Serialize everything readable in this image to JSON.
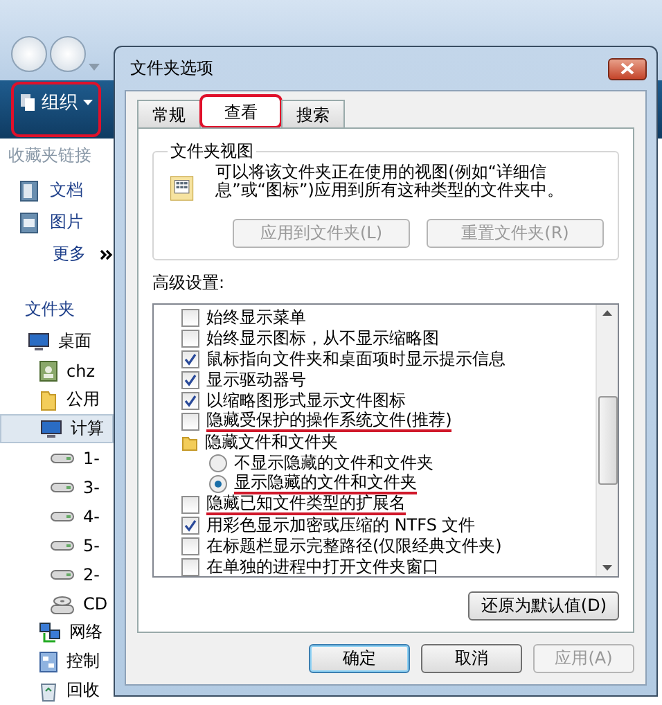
{
  "explorer": {
    "organize_button": {
      "label": "组织",
      "circled": true
    },
    "favorites_header": "收藏夹链接",
    "favorites": [
      {
        "label": "文档",
        "kind": "document"
      },
      {
        "label": "图片",
        "kind": "picture"
      }
    ],
    "more": "更多",
    "folders_header": "文件夹",
    "tree": [
      {
        "label": "桌面",
        "kind": "desktop",
        "selected": false,
        "children": [
          {
            "label": "chz",
            "kind": "user",
            "selected": false
          },
          {
            "label": "公用",
            "kind": "folder",
            "selected": false
          },
          {
            "label": "计算",
            "kind": "computer",
            "selected": true,
            "children": [
              {
                "label": "1-",
                "kind": "drive",
                "selected": false
              },
              {
                "label": "3-",
                "kind": "drive",
                "selected": false
              },
              {
                "label": "4-",
                "kind": "drive",
                "selected": false
              },
              {
                "label": "5-",
                "kind": "drive",
                "selected": false
              },
              {
                "label": "2-",
                "kind": "drive",
                "selected": false
              },
              {
                "label": "CD",
                "kind": "cdrom",
                "selected": false
              }
            ]
          },
          {
            "label": "网络",
            "kind": "network",
            "selected": false
          },
          {
            "label": "控制",
            "kind": "control",
            "selected": false
          },
          {
            "label": "回收",
            "kind": "recycle",
            "selected": false
          }
        ]
      }
    ]
  },
  "dialog": {
    "title": "文件夹选项",
    "tabs": [
      {
        "label": "常规",
        "selected": false,
        "circled": false
      },
      {
        "label": "查看",
        "selected": true,
        "circled": true
      },
      {
        "label": "搜索",
        "selected": false,
        "circled": false
      }
    ],
    "folder_view": {
      "title": "文件夹视图",
      "description": "可以将该文件夹正在使用的视图(例如“详细信息”或“图标”)应用到所有这种类型的文件夹中。",
      "buttons": [
        {
          "label": "应用到文件夹(L)",
          "disabled": true
        },
        {
          "label": "重置文件夹(R)",
          "disabled": true
        }
      ]
    },
    "advanced": {
      "label": "高级设置:",
      "items": [
        {
          "kind": "checkbox",
          "label": "始终显示菜单",
          "checked": false,
          "underlined": false
        },
        {
          "kind": "checkbox",
          "label": "始终显示图标，从不显示缩略图",
          "checked": false,
          "underlined": false
        },
        {
          "kind": "checkbox",
          "label": "鼠标指向文件夹和桌面项时显示提示信息",
          "checked": true,
          "underlined": false
        },
        {
          "kind": "checkbox",
          "label": "显示驱动器号",
          "checked": true,
          "underlined": false
        },
        {
          "kind": "checkbox",
          "label": "以缩略图形式显示文件图标",
          "checked": true,
          "underlined": false
        },
        {
          "kind": "checkbox",
          "label": "隐藏受保护的操作系统文件(推荐)",
          "checked": false,
          "underlined": true
        },
        {
          "kind": "group",
          "label": "隐藏文件和文件夹",
          "underlined": false,
          "children": [
            {
              "kind": "radio",
              "label": "不显示隐藏的文件和文件夹",
              "selected": false,
              "underlined": false
            },
            {
              "kind": "radio",
              "label": "显示隐藏的文件和文件夹",
              "selected": true,
              "underlined": true
            }
          ]
        },
        {
          "kind": "checkbox",
          "label": "隐藏已知文件类型的扩展名",
          "checked": false,
          "underlined": true
        },
        {
          "kind": "checkbox",
          "label": "用彩色显示加密或压缩的 NTFS 文件",
          "checked": true,
          "underlined": false
        },
        {
          "kind": "checkbox",
          "label": "在标题栏显示完整路径(仅限经典文件夹)",
          "checked": false,
          "underlined": false
        },
        {
          "kind": "checkbox",
          "label": "在单独的进程中打开文件夹窗口",
          "checked": false,
          "underlined": false
        }
      ]
    },
    "restore_button": "还原为默认值(D)",
    "buttons": [
      {
        "label": "确定",
        "default": true,
        "disabled": false
      },
      {
        "label": "取消",
        "default": false,
        "disabled": false
      },
      {
        "label": "应用(A)",
        "default": false,
        "disabled": true
      }
    ]
  }
}
